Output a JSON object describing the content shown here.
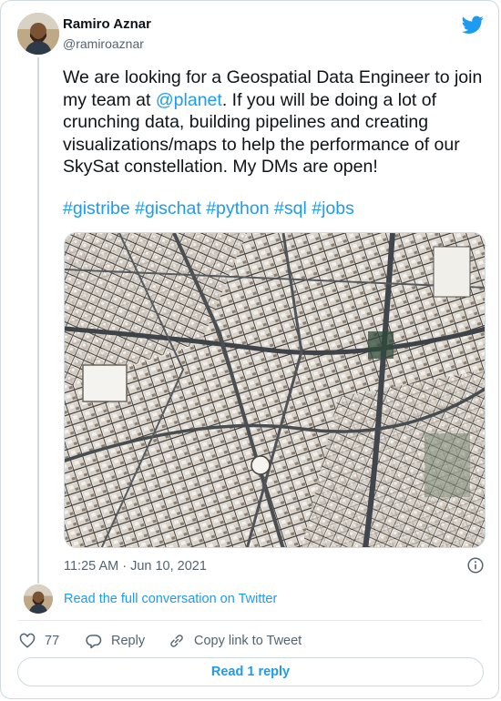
{
  "author": {
    "name": "Ramiro Aznar",
    "handle": "@ramiroaznar"
  },
  "tweet": {
    "text_before_mention": "We are looking for a Geospatial Data Engineer to join my team at ",
    "mention": "@planet",
    "text_after_mention": ". If you will be doing a lot of crunching data, building pipelines and creating visualizations/maps to help the performance of our SkySat constellation. My DMs are open!",
    "hashtags": [
      "#gistribe",
      "#gischat",
      "#python",
      "#sql",
      "#jobs"
    ]
  },
  "timestamp": "11:25 AM · Jun 10, 2021",
  "read_full_label": "Read the full conversation on Twitter",
  "actions": {
    "like_count": "77",
    "reply_label": "Reply",
    "copy_link_label": "Copy link to Tweet"
  },
  "read_reply_label": "Read 1 reply",
  "colors": {
    "accent": "#1d9bf0",
    "text": "#0f1419",
    "muted": "#536471",
    "border": "#cfd9de"
  },
  "icons": [
    "twitter-bird-icon",
    "info-icon",
    "heart-icon",
    "reply-icon",
    "link-icon"
  ]
}
